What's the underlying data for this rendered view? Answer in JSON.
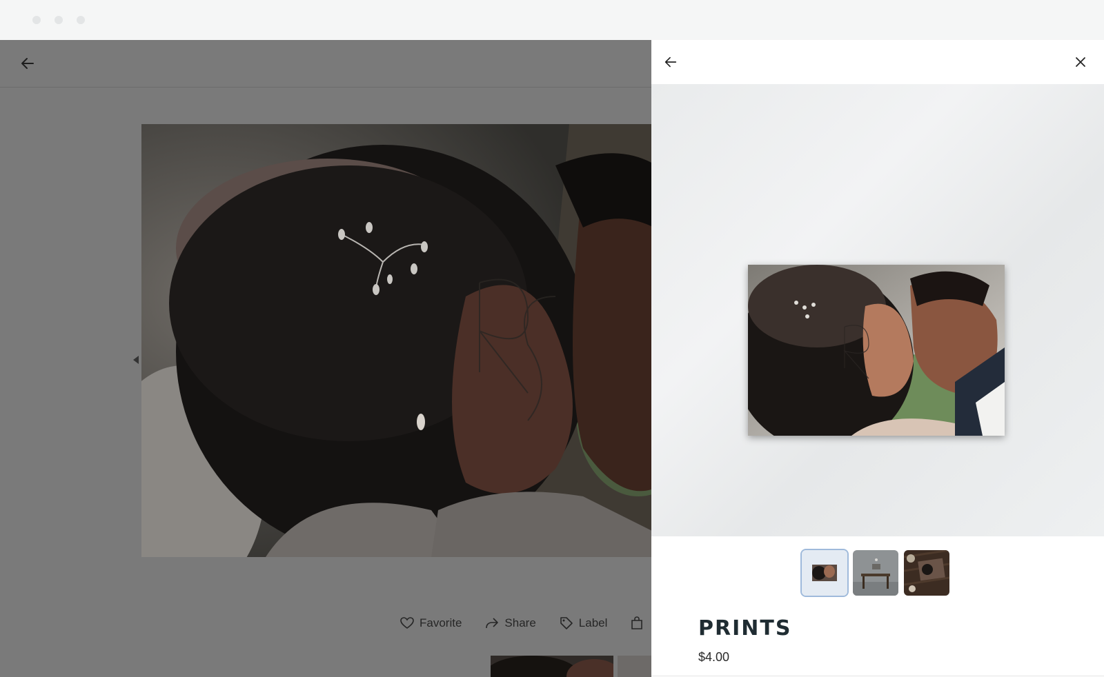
{
  "viewer": {
    "actions": [
      {
        "label": "Favorite",
        "icon": "heart-icon"
      },
      {
        "label": "Share",
        "icon": "share-icon"
      },
      {
        "label": "Label",
        "icon": "tag-icon"
      }
    ]
  },
  "panel": {
    "product_title": "PRINTS",
    "price": "$4.00",
    "thumbnails": [
      {
        "icon": "print-preview-thumbnail",
        "selected": true
      },
      {
        "icon": "desk-room-thumbnail",
        "selected": false
      },
      {
        "icon": "wood-table-thumbnail",
        "selected": false
      }
    ]
  },
  "colors": {
    "overlay": "#7a7a7a",
    "panel_bg": "#ffffff",
    "title": "#1f2c32",
    "selected_thumb_border": "#9fbadb"
  }
}
